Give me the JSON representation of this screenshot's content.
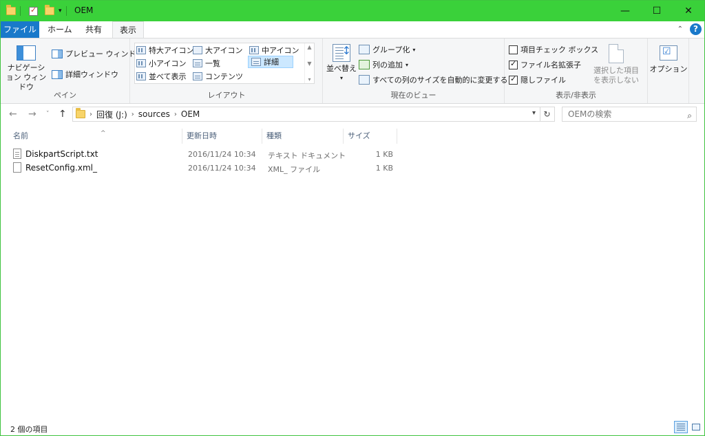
{
  "window": {
    "title": "OEM"
  },
  "titlebar": {
    "minimize": "—",
    "maximize": "☐",
    "close": "✕"
  },
  "tabs": {
    "file": "ファイル",
    "home": "ホーム",
    "share": "共有",
    "view": "表示"
  },
  "ribbon": {
    "pane": {
      "label": "ペイン",
      "nav_pane": "ナビゲーション ウィンドウ",
      "preview_pane": "プレビュー ウィンドウ",
      "details_pane": "詳細ウィンドウ"
    },
    "layout": {
      "label": "レイアウト",
      "extra_large": "特大アイコン",
      "large": "大アイコン",
      "medium": "中アイコン",
      "small": "小アイコン",
      "list": "一覧",
      "details": "詳細",
      "tiles": "並べて表示",
      "content": "コンテンツ"
    },
    "current_view": {
      "label": "現在のビュー",
      "sort_by": "並べ替え",
      "group_by": "グループ化",
      "add_columns": "列の追加",
      "size_all": "すべての列のサイズを自動的に変更する"
    },
    "show_hide": {
      "label": "表示/非表示",
      "item_checkboxes": "項目チェック ボックス",
      "item_checkboxes_checked": false,
      "file_extensions": "ファイル名拡張子",
      "file_extensions_checked": true,
      "hidden_items": "隠しファイル",
      "hidden_items_checked": true,
      "hide_selected": "選択した項目を表示しない"
    },
    "options": "オプション"
  },
  "address": {
    "crumbs": [
      "回復 (J:)",
      "sources",
      "OEM"
    ],
    "search_placeholder": "OEMの検索"
  },
  "columns": {
    "name": "名前",
    "date": "更新日時",
    "type": "種類",
    "size": "サイズ"
  },
  "files": [
    {
      "name": "DiskpartScript.txt",
      "date": "2016/11/24 10:34",
      "type": "テキスト ドキュメント",
      "size": "1 KB",
      "icon": "text-file-icon"
    },
    {
      "name": "ResetConfig.xml_",
      "date": "2016/11/24 10:34",
      "type": "XML_ ファイル",
      "size": "1 KB",
      "icon": "file-icon"
    }
  ],
  "status": {
    "item_count": "2 個の項目"
  }
}
